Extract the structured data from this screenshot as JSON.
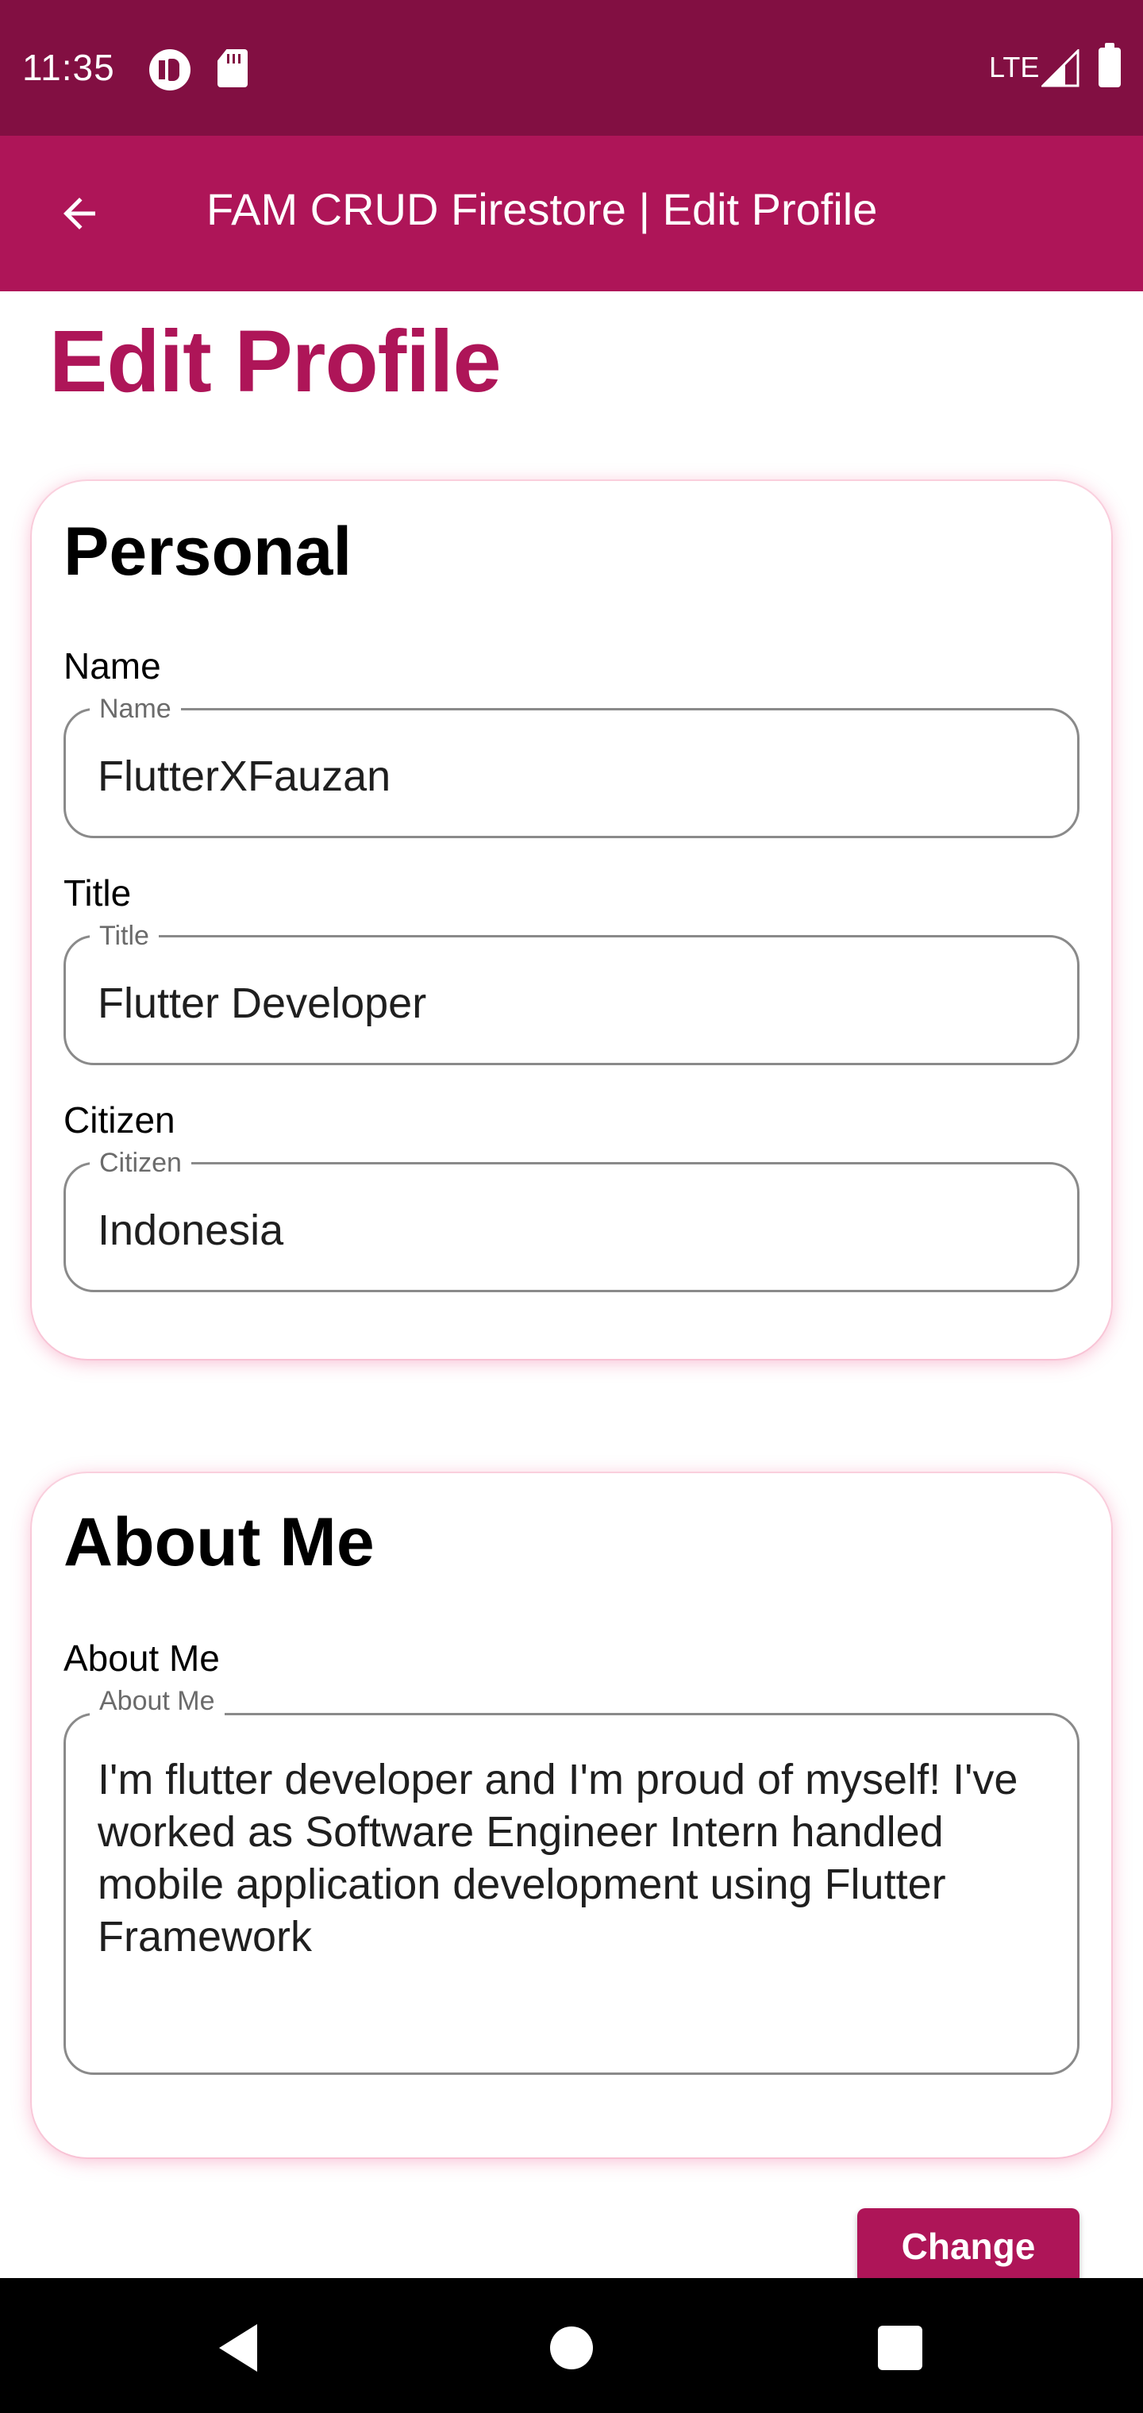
{
  "status_bar": {
    "time": "11:35",
    "network": "LTE",
    "icons": [
      "privacy-dot-icon",
      "sd-card-icon",
      "signal-icon",
      "battery-icon"
    ]
  },
  "app_bar": {
    "title": "FAM CRUD Firestore | Edit Profile",
    "back_icon": "arrow-back-icon",
    "color": "#ae1558"
  },
  "page": {
    "title": "Edit Profile"
  },
  "personal": {
    "title": "Personal",
    "fields": [
      {
        "label": "Name",
        "legend": "Name",
        "value": "FlutterXFauzan"
      },
      {
        "label": "Title",
        "legend": "Title",
        "value": "Flutter Developer"
      },
      {
        "label": "Citizen",
        "legend": "Citizen",
        "value": "Indonesia"
      }
    ]
  },
  "about": {
    "title": "About Me",
    "label": "About Me",
    "legend": "About Me",
    "value": "I'm flutter developer and I'm proud of myself! I've worked as Software Engineer Intern handled mobile application development using Flutter Framework"
  },
  "actions": {
    "change_label": "Change"
  },
  "nav_bar": {
    "icons": [
      "nav-back-icon",
      "nav-home-icon",
      "nav-recents-icon"
    ]
  },
  "colors": {
    "status_bar": "#820f42",
    "accent": "#ae1558",
    "card_shadow": "#ec407a"
  }
}
